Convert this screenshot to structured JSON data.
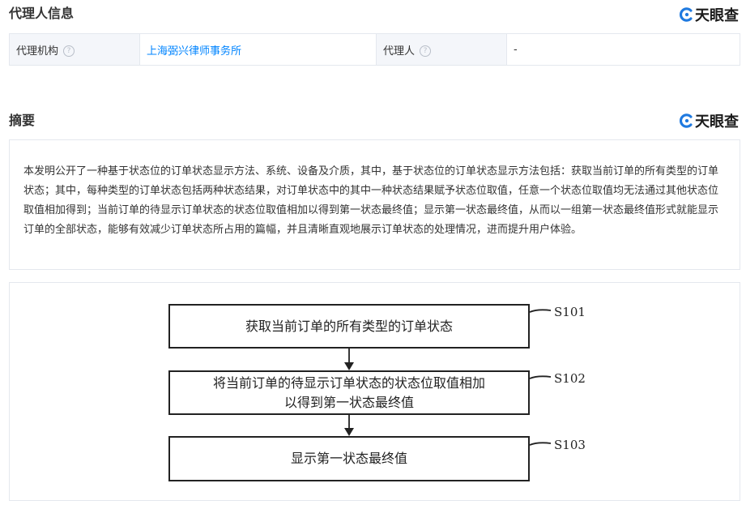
{
  "agent_section": {
    "title": "代理人信息",
    "brand": "天眼查",
    "agency_label": "代理机构",
    "agency_value": "上海弼兴律师事务所",
    "agent_label": "代理人",
    "agent_value": "-",
    "help_glyph": "?"
  },
  "abstract_section": {
    "title": "摘要",
    "brand": "天眼查",
    "text": "本发明公开了一种基于状态位的订单状态显示方法、系统、设备及介质，其中，基于状态位的订单状态显示方法包括：获取当前订单的所有类型的订单状态；其中，每种类型的订单状态包括两种状态结果，对订单状态中的其中一种状态结果赋予状态位取值，任意一个状态位取值均无法通过其他状态位取值相加得到；当前订单的待显示订单状态的状态位取值相加以得到第一状态最终值；显示第一状态最终值，从而以一组第一状态最终值形式就能显示订单的全部状态，能够有效减少订单状态所占用的篇幅，并且清晰直观地展示订单状态的处理情况，进而提升用户体验。"
  },
  "figure": {
    "steps": [
      {
        "text": "获取当前订单的所有类型的订单状态",
        "label": "S101"
      },
      {
        "text": "将当前订单的待显示订单状态的状态位取值相加以得到第一状态最终值",
        "label": "S102"
      },
      {
        "text": "显示第一状态最终值",
        "label": "S103"
      }
    ]
  },
  "colors": {
    "link": "#0084ff",
    "brand_logo": "#1f7ae0",
    "border": "#e4e8ee",
    "label_bg": "#f4f6fa"
  }
}
